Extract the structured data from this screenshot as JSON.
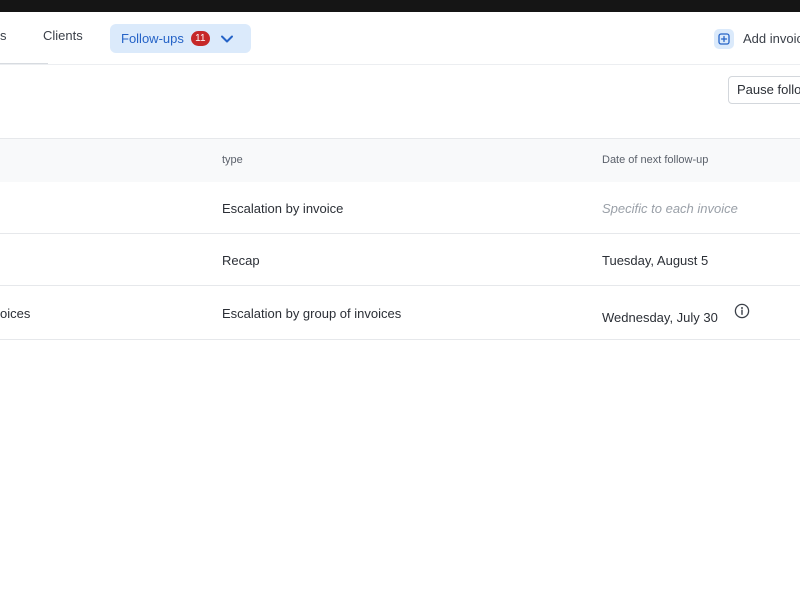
{
  "nav": {
    "tab_cut_label": "s",
    "tab_clients_label": "Clients",
    "tab_followups_label": "Follow-ups",
    "followups_badge": "11",
    "add_invoice_label": "Add invoic",
    "icons": {
      "chevron": "chevron-down-icon",
      "add": "plus-square-icon"
    }
  },
  "toolbar": {
    "pause_label": "Pause follo"
  },
  "table": {
    "columns": [
      "type",
      "Date of next follow-up"
    ],
    "rows": [
      {
        "name": "",
        "type": "Escalation by invoice",
        "next_date": "Specific to each invoice",
        "next_date_is_placeholder": true
      },
      {
        "name": "",
        "type": "Recap",
        "next_date": "Tuesday, August 5",
        "next_date_is_placeholder": false
      },
      {
        "name": "oices",
        "type": "Escalation by group of invoices",
        "next_date": "Wednesday, July 30",
        "next_date_is_placeholder": false,
        "info_icon": "info-circle-icon"
      }
    ]
  },
  "colors": {
    "accent": "#2563c7",
    "tab_active_bg": "#dbeafb",
    "badge_bg": "#c62828",
    "header_bg": "#f8f9fa",
    "placeholder_text": "#9aa0a8"
  }
}
